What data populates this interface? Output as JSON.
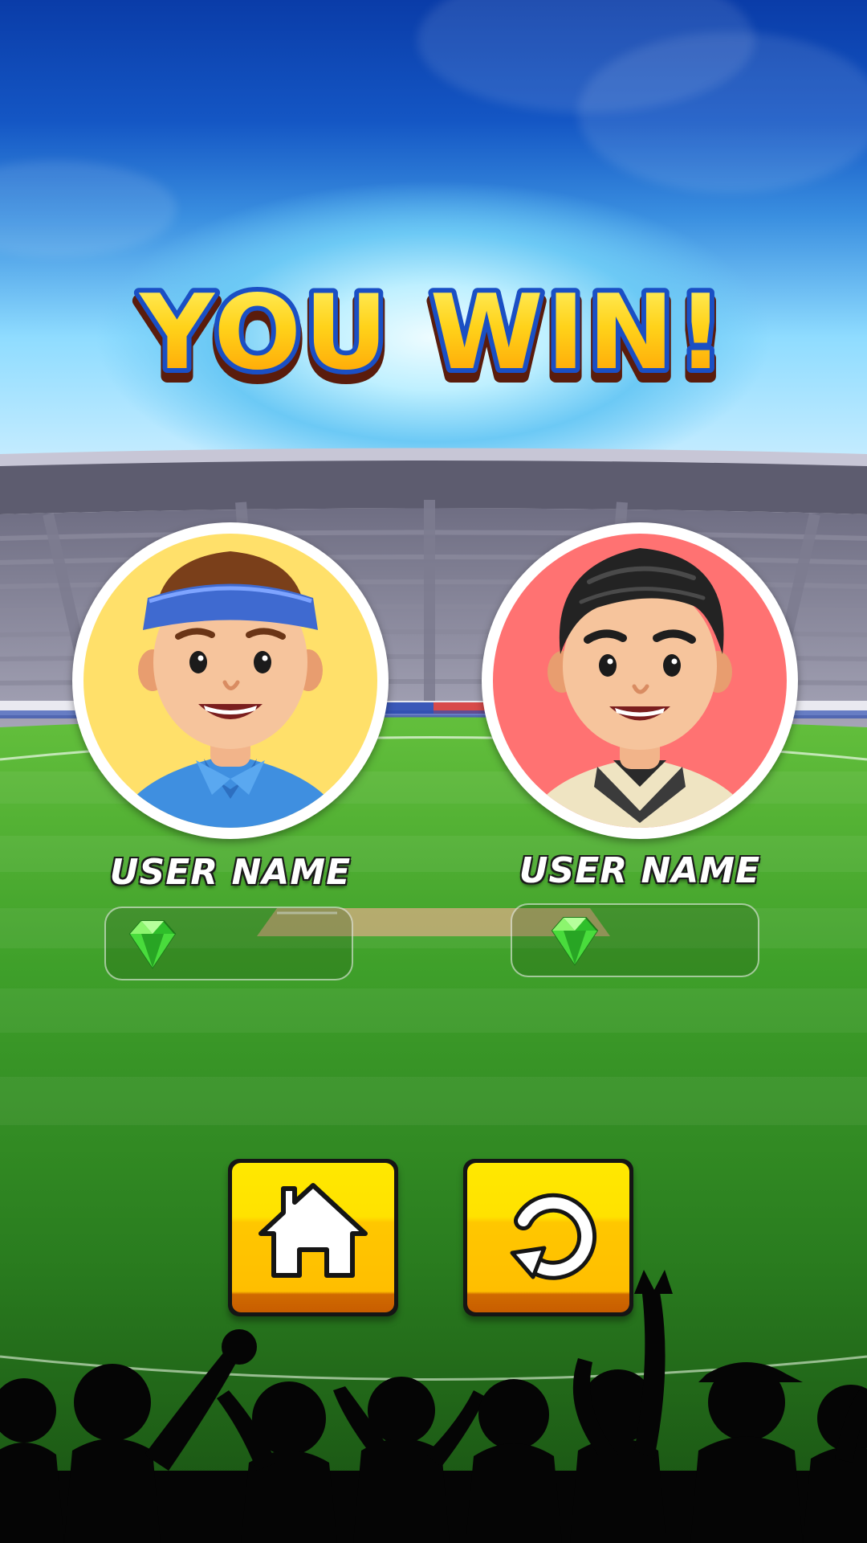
{
  "title": "YOU WIN!",
  "players": [
    {
      "name": "USER NAME",
      "avatar_bg": "#ffe06a",
      "gems": ""
    },
    {
      "name": "USER NAME",
      "avatar_bg": "#ff7272",
      "gems": ""
    }
  ],
  "buttons": {
    "home_icon": "home-icon",
    "replay_icon": "replay-icon"
  },
  "colors": {
    "title_fill": "#ffc20a",
    "button_yellow": "#ffe200",
    "gem_green": "#3ed43a"
  }
}
